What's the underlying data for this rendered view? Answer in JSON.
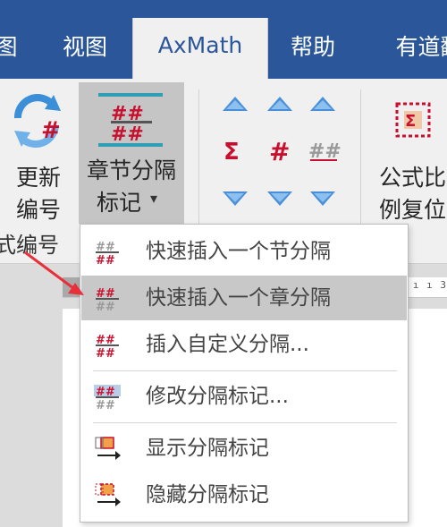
{
  "tabs": [
    {
      "label": "图",
      "active": false
    },
    {
      "label": "视图",
      "active": false
    },
    {
      "label": "AxMath",
      "active": true
    },
    {
      "label": "帮助",
      "active": false
    },
    {
      "label": "有道翻",
      "active": false
    }
  ],
  "ribbon": {
    "update_numbering": {
      "line1": "更新",
      "line2": "编号"
    },
    "section_break_mark": {
      "line1": "章节分隔",
      "line2": "标记",
      "dropdown_caret": "▾"
    },
    "formula_ratio_reset": {
      "line1": "公式比",
      "line2": "例复位"
    },
    "group_label": "式编号"
  },
  "ruler_ticks": "ı | ı ı 3",
  "menu": {
    "items": [
      {
        "label": "快速插入一个节分隔",
        "highlighted": false
      },
      {
        "label": "快速插入一个章分隔",
        "highlighted": true
      },
      {
        "label": "插入自定义分隔...",
        "highlighted": false
      },
      {
        "label": "修改分隔标记...",
        "highlighted": false
      },
      {
        "label": "显示分隔标记",
        "highlighted": false
      },
      {
        "label": "隐藏分隔标记",
        "highlighted": false
      }
    ]
  },
  "colors": {
    "tab_bar": "#2b579a",
    "accent_red": "#c8102e",
    "accent_blue": "#3b8ed8",
    "menu_highlight": "#c8c8c8",
    "annotation_arrow": "#e8303a"
  }
}
